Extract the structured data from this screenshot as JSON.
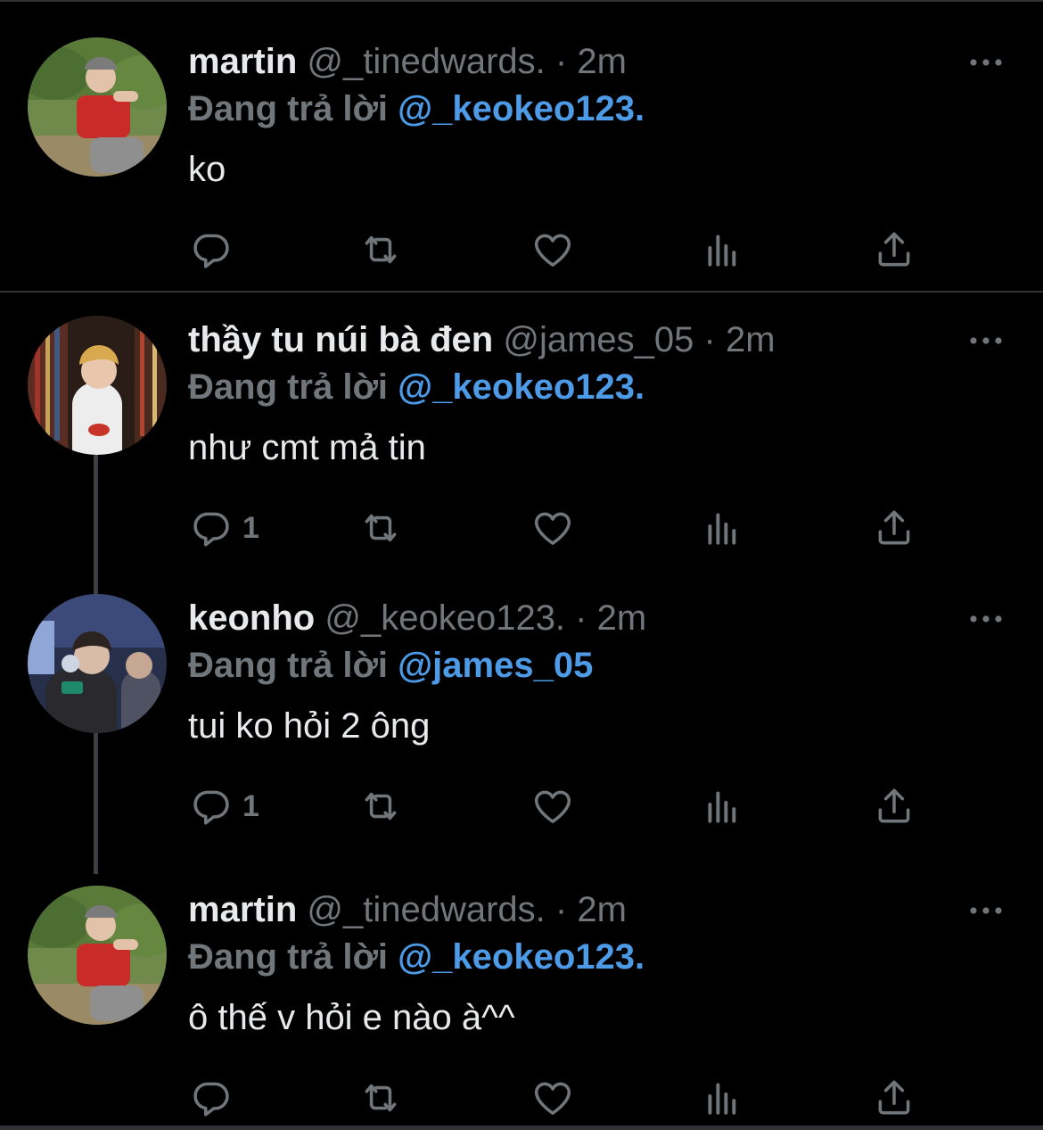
{
  "colors": {
    "background": "#000000",
    "divider": "#2f3336",
    "text_primary": "#e7e9ea",
    "text_secondary": "#71767b",
    "mention": "#4d9ae6"
  },
  "tweets": [
    {
      "name": "martin",
      "handle": "@_tinedwards.",
      "dot": "·",
      "time": "2m",
      "reply_prefix": "Đang trả lời",
      "reply_to": "@_keokeo123.",
      "text": "ko",
      "reply_count": "",
      "avatar": "martin-avatar"
    },
    {
      "name": "thầy tu núi bà đen",
      "handle": "@james_05",
      "dot": "·",
      "time": "2m",
      "reply_prefix": "Đang trả lời",
      "reply_to": "@_keokeo123.",
      "text": "như cmt mả tin",
      "reply_count": "1",
      "avatar": "james-avatar"
    },
    {
      "name": "keonho",
      "handle": "@_keokeo123.",
      "dot": "·",
      "time": "2m",
      "reply_prefix": "Đang trả lời",
      "reply_to": "@james_05",
      "text": "tui ko hỏi 2 ông",
      "reply_count": "1",
      "avatar": "keonho-avatar"
    },
    {
      "name": "martin",
      "handle": "@_tinedwards.",
      "dot": "·",
      "time": "2m",
      "reply_prefix": "Đang trả lời",
      "reply_to": "@_keokeo123.",
      "text": "ô thế v hỏi e nào à^^",
      "reply_count": "",
      "avatar": "martin-avatar"
    }
  ],
  "icons": {
    "reply": "reply-icon",
    "retweet": "retweet-icon",
    "like": "heart-icon",
    "views": "views-icon",
    "share": "share-icon",
    "more": "more-icon"
  }
}
